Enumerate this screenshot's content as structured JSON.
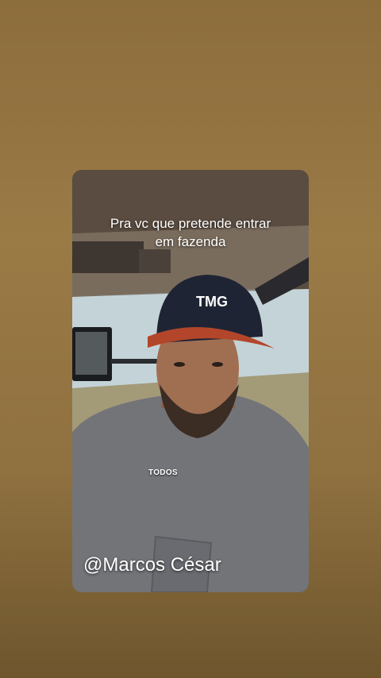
{
  "story": {
    "caption_lines": [
      "Pra vc que pretende entrar",
      "em fazenda"
    ],
    "cap_logo_text": "TMG",
    "overlay_label": "TODOS",
    "handle": "@Marcos César"
  },
  "colors": {
    "background": "#8c6d3c",
    "cap": "#1e2433",
    "cap_brim": "#b3462a",
    "shirt": "#737478"
  },
  "icons": [
    "tractor-cab-scene",
    "cap-logo"
  ]
}
